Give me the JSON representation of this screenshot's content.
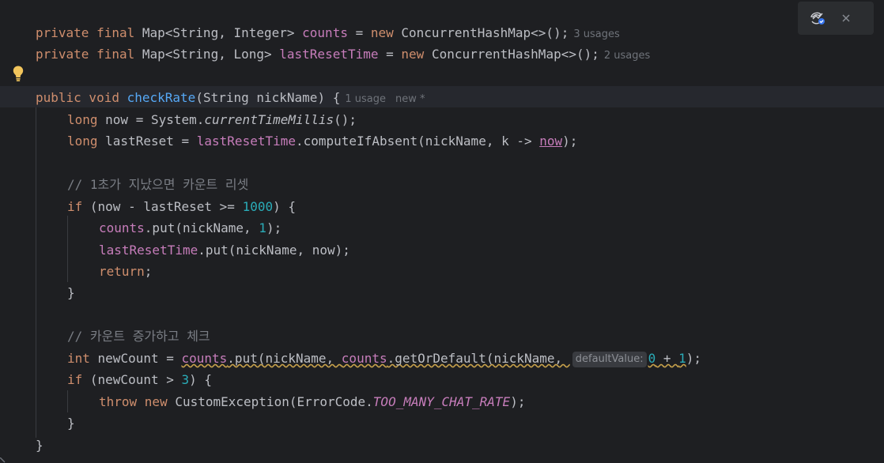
{
  "toolbar": {
    "ai_icon": "ai-assistant-icon",
    "close_icon": "close-icon"
  },
  "hints": {
    "counts_usages": "3 usages",
    "last_reset_usages": "2 usages",
    "method_usages": "1 usage",
    "method_status": "new *",
    "inlay_default_value": "defaultValue:"
  },
  "code": {
    "l1": {
      "kw": "private final",
      "type": " Map<String, Integer> ",
      "field": "counts",
      "eq": " = ",
      "new": "new",
      "rest": " ConcurrentHashMap<>();"
    },
    "l2": {
      "kw": "private final",
      "type": " Map<String, Long> ",
      "field": "lastResetTime",
      "eq": " = ",
      "new": "new",
      "rest": " ConcurrentHashMap<>();"
    },
    "l3": {
      "kw": "public void",
      "sp": " ",
      "fn": "checkRate",
      "rest": "(String nickName) {"
    },
    "l4": {
      "kw": "long",
      "a": " now = System.",
      "b": "currentTimeMillis",
      "c": "();"
    },
    "l5": {
      "kw": "long",
      "a": " lastReset = ",
      "field": "lastResetTime",
      "b": ".computeIfAbsent(nickName, k -> ",
      "now": "now",
      "c": ");"
    },
    "l6": {
      "comment": "// 1초가 지났으면 카운트 리셋"
    },
    "l7": {
      "kw": "if",
      "a": " (now - lastReset >= ",
      "num": "1000",
      "b": ") {"
    },
    "l8": {
      "field": "counts",
      "a": ".put(nickName, ",
      "num": "1",
      "b": ");"
    },
    "l9": {
      "field": "lastResetTime",
      "a": ".put(nickName, now);"
    },
    "l10": {
      "kw": "return",
      "a": ";"
    },
    "l11": {
      "a": "}"
    },
    "l12": {
      "comment": "// 카운트 증가하고 체크"
    },
    "l13": {
      "kw": "int",
      "a": " newCount = ",
      "f1": "counts",
      "b": ".put(nickName, ",
      "f2": "counts",
      "c": ".getOrDefault(nickName, ",
      "n0": "0",
      "d": " + ",
      "n1": "1",
      "e": ");"
    },
    "l14": {
      "kw": "if",
      "a": " (newCount > ",
      "num": "3",
      "b": ") {"
    },
    "l15": {
      "kw": "throw new",
      "a": " CustomException(ErrorCode.",
      "cnst": "TOO_MANY_CHAT_RATE",
      "b": ");"
    },
    "l16": {
      "a": "}"
    },
    "l17": {
      "a": "}"
    }
  }
}
